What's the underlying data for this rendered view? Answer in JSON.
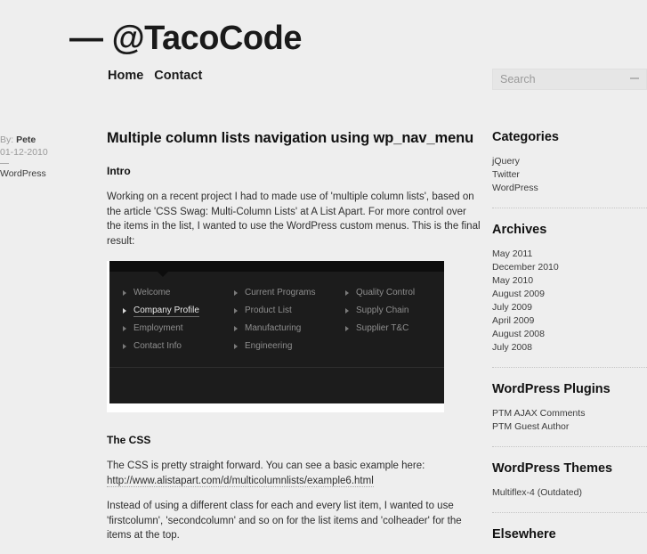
{
  "header": {
    "site_title_dash": "—",
    "site_title": "@TacoCode",
    "nav": [
      {
        "label": "Home"
      },
      {
        "label": "Contact"
      }
    ],
    "search": {
      "placeholder": "Search",
      "value": "",
      "icon": "search-dash-icon"
    }
  },
  "post_meta": {
    "by_prefix": "By:",
    "author": "Pete",
    "date": "01-12-2010",
    "category": "WordPress"
  },
  "post": {
    "title": "Multiple column lists navigation using wp_nav_menu",
    "intro_heading": "Intro",
    "intro_paragraph": "Working on a recent project I had to made use of 'multiple column lists', based on the article 'CSS Swag: Multi-Column Lists' at A List Apart. For more control over the items in the list, I wanted to use the WordPress custom menus. This is the final result:",
    "css_heading": "The CSS",
    "css_paragraph_1": "The CSS is pretty straight forward. You can see a basic example here:",
    "css_link": "http://www.alistapart.com/d/multicolumnlists/example6.html",
    "css_paragraph_2": "Instead of using a different class for each and every list item, I wanted to use  'firstcolumn', 'secondcolumn' and so on for the list items and 'colheader' for the items at the top."
  },
  "demo": {
    "columns": [
      {
        "items": [
          {
            "label": "Welcome",
            "active": false
          },
          {
            "label": "Company Profile",
            "active": true
          },
          {
            "label": "Employment",
            "active": false
          },
          {
            "label": "Contact Info",
            "active": false
          }
        ]
      },
      {
        "items": [
          {
            "label": "Current Programs",
            "active": false
          },
          {
            "label": "Product List",
            "active": false
          },
          {
            "label": "Manufacturing",
            "active": false
          },
          {
            "label": "Engineering",
            "active": false
          }
        ]
      },
      {
        "items": [
          {
            "label": "Quality Control",
            "active": false
          },
          {
            "label": "Supply Chain",
            "active": false
          },
          {
            "label": "Supplier T&C",
            "active": false
          }
        ]
      }
    ]
  },
  "sidebar": {
    "sections": [
      {
        "heading": "Categories",
        "items": [
          "jQuery",
          "Twitter",
          "WordPress"
        ]
      },
      {
        "heading": "Archives",
        "items": [
          "May 2011",
          "December 2010",
          "May 2010",
          "August 2009",
          "July 2009",
          "April 2009",
          "August 2008",
          "July 2008"
        ]
      },
      {
        "heading": "WordPress Plugins",
        "items": [
          "PTM AJAX Comments",
          "PTM Guest Author"
        ]
      },
      {
        "heading": "WordPress Themes",
        "items": [
          "Multiflex-4 (Outdated)"
        ]
      },
      {
        "heading": "Elsewhere",
        "items": []
      }
    ]
  },
  "colors": {
    "page_bg": "#eeeeee",
    "text": "#222222",
    "demo_panel": "#1c1c1c",
    "demo_topbar": "#0d0d0d",
    "demo_item": "#8e8e8e",
    "demo_item_active": "#e8e8e8"
  }
}
